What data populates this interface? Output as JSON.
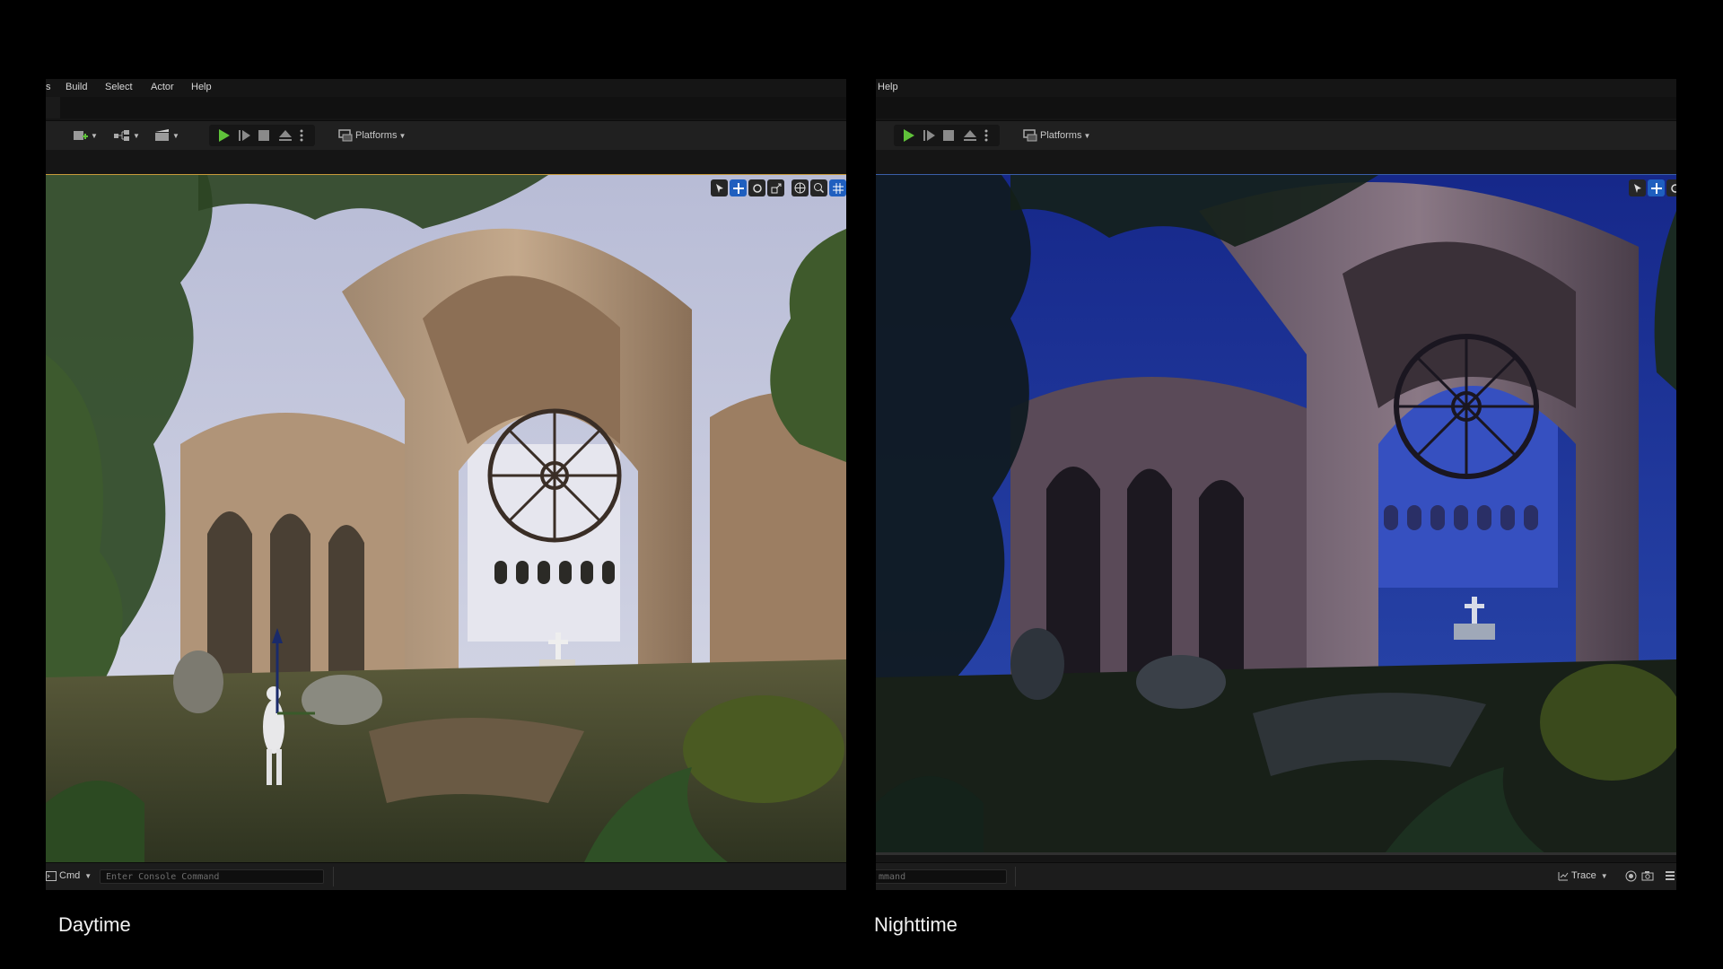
{
  "left_panel": {
    "menu": [
      "s",
      "Build",
      "Select",
      "Actor",
      "Help"
    ],
    "platforms_label": "Platforms",
    "console_cmd_label": "Cmd",
    "console_placeholder": "Enter Console Command",
    "caption": "Daytime"
  },
  "right_panel": {
    "menu": [
      "Help"
    ],
    "platforms_label": "Platforms",
    "console_placeholder": "mmand",
    "trace_label": "Trace",
    "caption": "Nighttime"
  },
  "colors": {
    "play_green": "#5fc23a",
    "active_blue": "#1f5fbf",
    "day_sky": "#c9cde0",
    "night_sky": "#1b2f8a"
  },
  "icons": [
    "add-actor-icon",
    "blueprint-icon",
    "cinematics-icon",
    "play-icon",
    "step-icon",
    "stop-icon",
    "eject-icon",
    "more-icon",
    "platforms-icon",
    "select-icon",
    "translate-icon",
    "rotate-icon",
    "scale-icon",
    "world-icon",
    "snap-icon",
    "grid-icon",
    "trace-icon",
    "camera-icon"
  ]
}
